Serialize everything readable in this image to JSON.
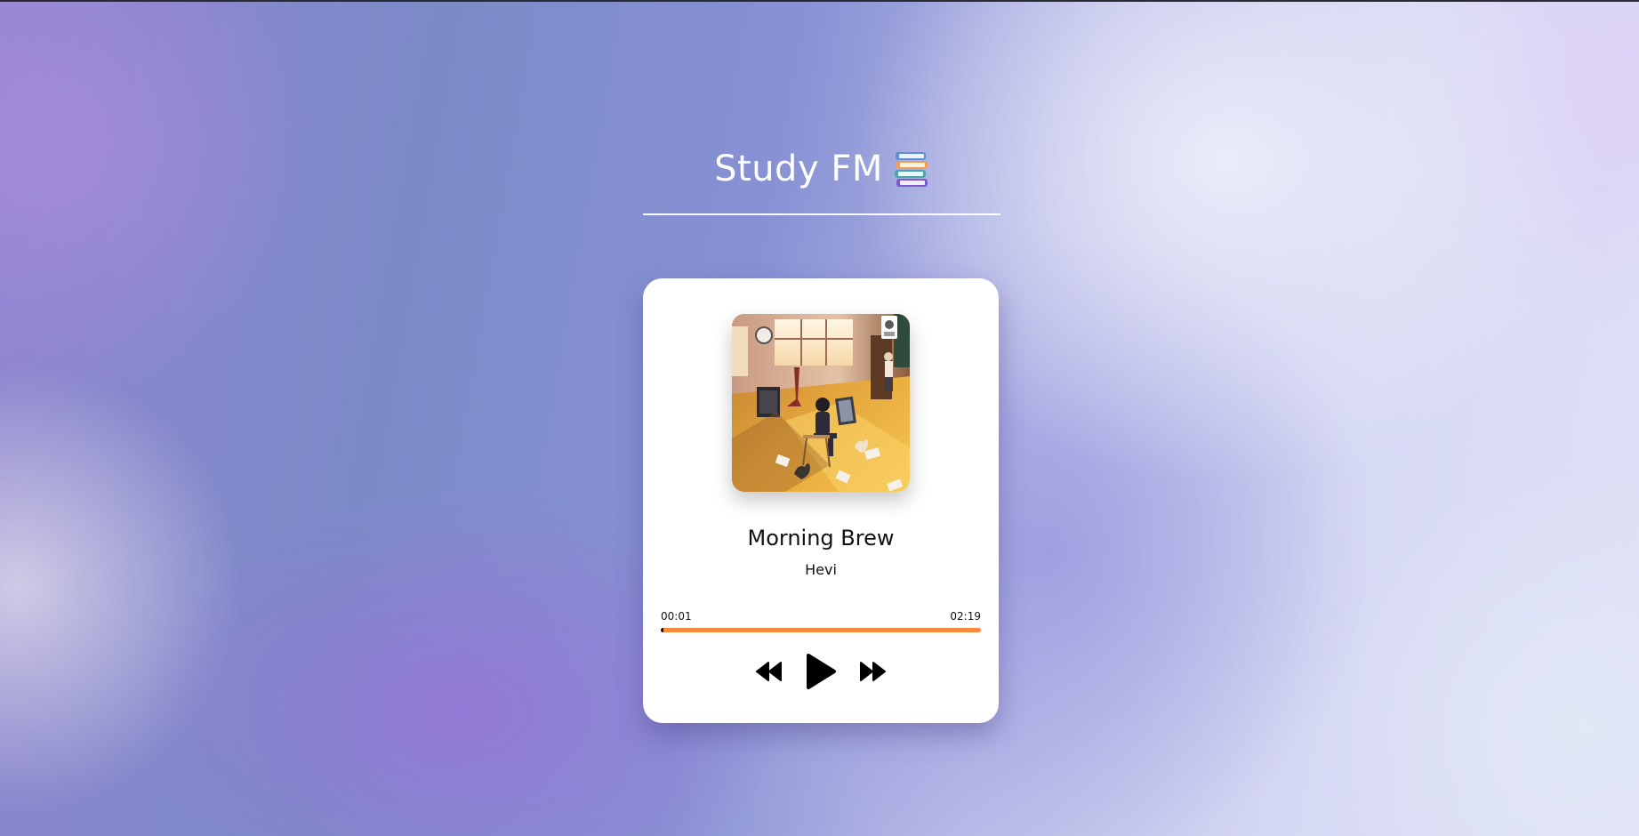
{
  "app": {
    "title": "Study FM",
    "title_icon": "books-icon"
  },
  "player": {
    "album_art": {
      "icon": "album-art-image"
    },
    "track": {
      "title": "Morning Brew",
      "artist": "Hevi"
    },
    "time": {
      "current": "00:01",
      "total": "02:19"
    },
    "progress_fraction": 0.007,
    "controls": {
      "previous": "rewind-icon",
      "play": "play-icon",
      "next": "fast-forward-icon"
    }
  },
  "colors": {
    "progress_track": "#ff8a3d",
    "progress_fill": "#111111",
    "card_background": "#ffffff",
    "title_text": "#ffffff"
  }
}
